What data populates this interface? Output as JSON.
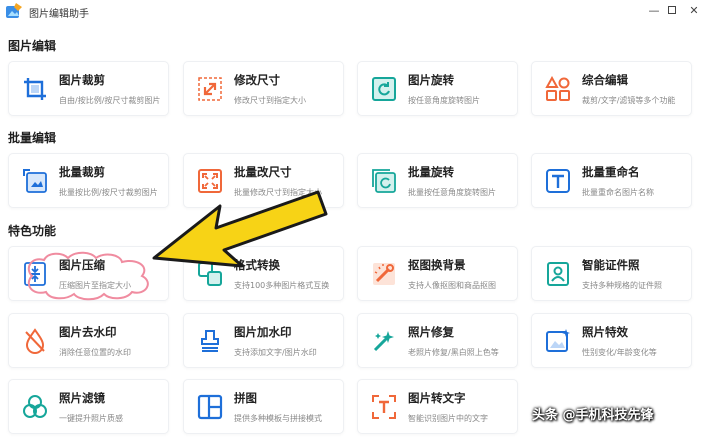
{
  "window": {
    "title": "图片编辑助手",
    "min_glyph": "—",
    "close_glyph": "✕"
  },
  "colors": {
    "blue": "#1e6fd9",
    "orange": "#f0683a",
    "teal": "#16a69a",
    "card_border": "#eef0f3",
    "arrow_yellow": "#f7d316"
  },
  "sections": [
    {
      "title": "图片编辑",
      "cards": [
        {
          "title": "图片裁剪",
          "desc": "自由/按比例/按尺寸裁剪图片",
          "icon": "crop-icon"
        },
        {
          "title": "修改尺寸",
          "desc": "修改尺寸到指定大小",
          "icon": "resize-icon"
        },
        {
          "title": "图片旋转",
          "desc": "按任意角度旋转图片",
          "icon": "rotate-icon"
        },
        {
          "title": "综合编辑",
          "desc": "裁剪/文字/滤镜等多个功能",
          "icon": "shapes-icon"
        }
      ]
    },
    {
      "title": "批量编辑",
      "cards": [
        {
          "title": "批量裁剪",
          "desc": "批量按比例/按尺寸裁剪图片",
          "icon": "batch-crop-icon"
        },
        {
          "title": "批量改尺寸",
          "desc": "批量修改尺寸到指定大小",
          "icon": "batch-resize-icon"
        },
        {
          "title": "批量旋转",
          "desc": "批量按任意角度旋转图片",
          "icon": "batch-rotate-icon"
        },
        {
          "title": "批量重命名",
          "desc": "批量重命名图片名称",
          "icon": "rename-icon"
        }
      ]
    },
    {
      "title": "特色功能",
      "cards": [
        {
          "title": "图片压缩",
          "desc": "压缩图片至指定大小",
          "icon": "compress-icon"
        },
        {
          "title": "格式转换",
          "desc": "支持100多种图片格式互换",
          "icon": "format-convert-icon"
        },
        {
          "title": "抠图换背景",
          "desc": "支持人像抠图和商品抠图",
          "icon": "cutout-icon"
        },
        {
          "title": "智能证件照",
          "desc": "支持多种规格的证件照",
          "icon": "id-photo-icon"
        },
        {
          "title": "图片去水印",
          "desc": "消除任意位置的水印",
          "icon": "remove-watermark-icon"
        },
        {
          "title": "图片加水印",
          "desc": "支持添加文字/图片水印",
          "icon": "add-watermark-icon"
        },
        {
          "title": "照片修复",
          "desc": "老照片修复/黑白照上色等",
          "icon": "repair-icon"
        },
        {
          "title": "照片特效",
          "desc": "性别变化/年龄变化等",
          "icon": "effects-icon"
        },
        {
          "title": "照片滤镜",
          "desc": "一键提升照片质感",
          "icon": "filter-icon"
        },
        {
          "title": "拼图",
          "desc": "提供多种模板与拼接模式",
          "icon": "collage-icon"
        },
        {
          "title": "图片转文字",
          "desc": "智能识别图片中的文字",
          "icon": "ocr-icon"
        }
      ]
    }
  ],
  "watermark": "头条 @手机科技先锋"
}
